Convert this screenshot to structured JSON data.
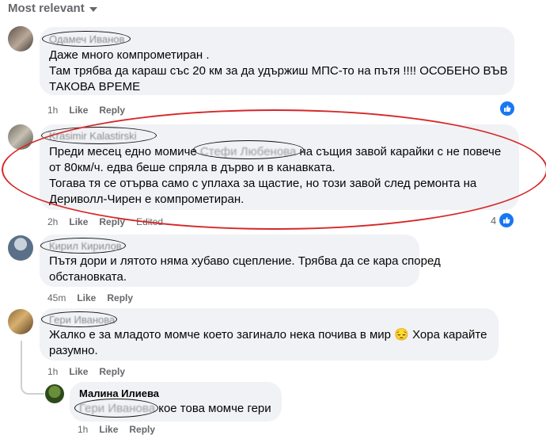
{
  "sort": {
    "label": "Most relevant"
  },
  "comments": [
    {
      "author": "Одамеч Иванов",
      "lines": [
        "Даже много компрометиран .",
        "Там трябва да караш със 20 км за да удържиш МПС-то на пътя !!!! ОСОБЕНО ВЪВ",
        "ТАКОВА ВРЕМЕ"
      ],
      "time": "1h",
      "like": "Like",
      "reply": "Reply",
      "reactions": ""
    },
    {
      "author": "Krasimir Kalastirski",
      "line1_pre": "Преди месец едно момиче ",
      "line1_tag": "Стефи Любенова",
      "line1_post": " на същия завой карайки с не повече",
      "lines": [
        "от 80км/ч. едва беше спряла в дърво и в канавката.",
        "Тогава тя се отърва само с уплаха за щастие, но този завой след ремонта на",
        "Дериволл-Чирен е компрометиран."
      ],
      "time": "2h",
      "like": "Like",
      "reply": "Reply",
      "edited": "Edited",
      "reactions": "4"
    },
    {
      "author": "Кирил Кирилов",
      "lines": [
        "Пътя дори и лятото няма хубаво сцепление. Трябва да се кара според",
        "обстановката."
      ],
      "time": "45m",
      "like": "Like",
      "reply": "Reply"
    },
    {
      "author": "Гери Иванова",
      "lines": [
        "Жалко е за младото момче което загинало нека почива в мир",
        "разумно."
      ],
      "line1_tail": "Хора карайте",
      "emoji": "😔",
      "time": "1h",
      "like": "Like",
      "reply": "Reply"
    }
  ],
  "reply": {
    "author": "Малина Илиева",
    "tag": "Гери Иванова",
    "text": " кое това момче гери",
    "time": "1h",
    "like": "Like",
    "reply": "Reply"
  },
  "colors": {
    "bubble": "#f0f2f5",
    "meta": "#65676b",
    "like_blue": "#1877f2",
    "annotation_red": "#d62828"
  },
  "icons": {
    "sort": "chevron-down-icon",
    "reaction": "like-reaction-icon"
  }
}
